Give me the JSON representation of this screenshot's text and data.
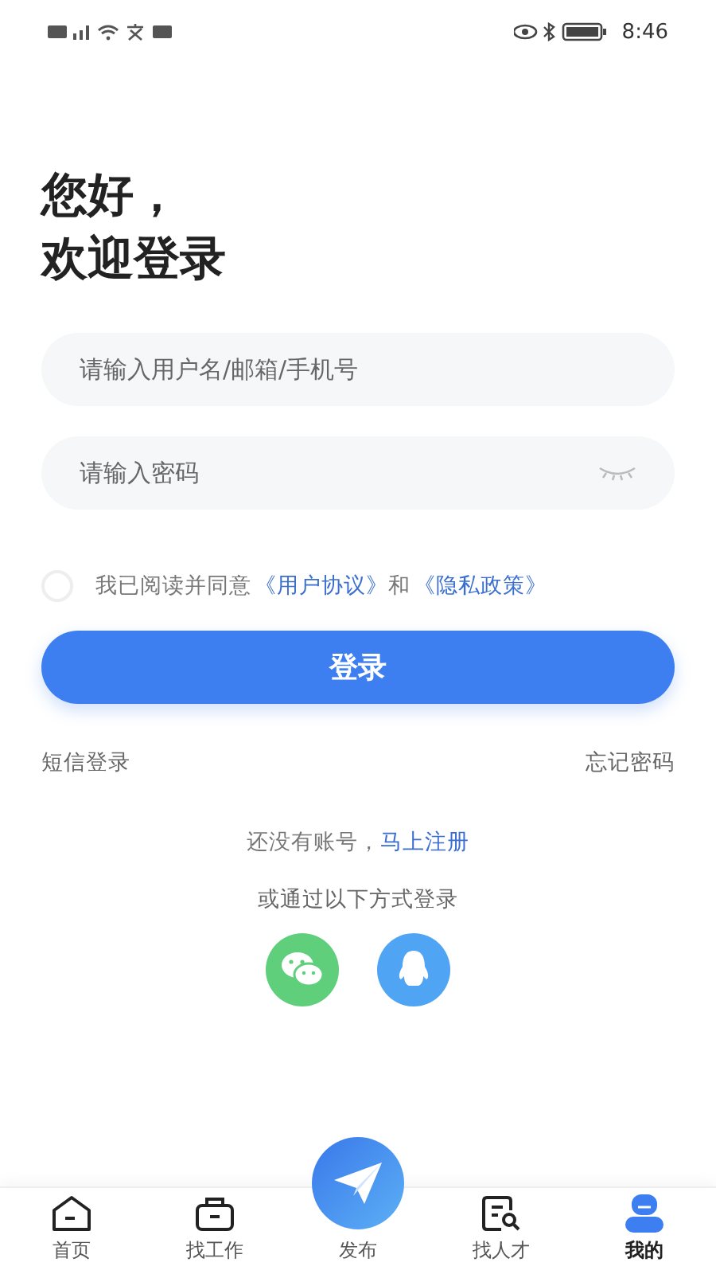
{
  "status_bar": {
    "time": "8:46"
  },
  "greeting": {
    "line_1": "您好，",
    "line_2": "欢迎登录"
  },
  "username_field": {
    "placeholder": "请输入用户名/邮箱/手机号"
  },
  "password_field": {
    "placeholder": "请输入密码"
  },
  "agreement": {
    "checked": false,
    "text": "我已阅读并同意",
    "link_1": "《用户协议》",
    "joiner": "和",
    "link_2": "《隐私政策》"
  },
  "login_button": "登录",
  "sms_login": "短信登录",
  "forgot_password": "忘记密码",
  "register": {
    "text": "还没有账号，",
    "link": "马上注册"
  },
  "other_methods": "或通过以下方式登录",
  "social_logins": [
    {
      "kind": "wechat"
    },
    {
      "kind": "qq"
    }
  ],
  "tab_bar": [
    {
      "kind": "home",
      "label": "首页",
      "selected": false
    },
    {
      "kind": "jobs",
      "label": "找工作",
      "selected": false
    },
    {
      "kind": "publish",
      "label": "发布",
      "selected": false
    },
    {
      "kind": "talent",
      "label": "找人才",
      "selected": false
    },
    {
      "kind": "profile",
      "label": "我的",
      "selected": true
    }
  ]
}
